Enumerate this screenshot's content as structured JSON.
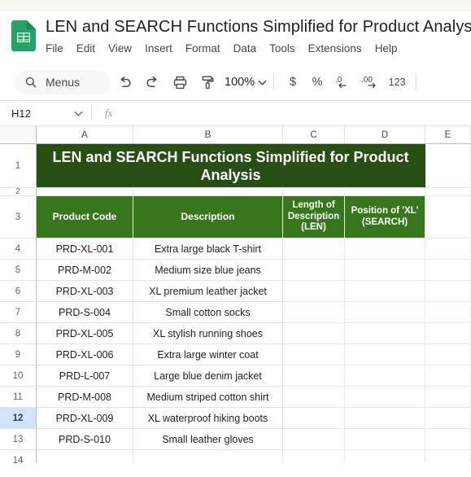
{
  "app": {
    "logo_icon": "google-sheets-icon",
    "doc_title": "LEN and SEARCH Functions Simplified for Product Analys",
    "menus": [
      "File",
      "Edit",
      "View",
      "Insert",
      "Format",
      "Data",
      "Tools",
      "Extensions",
      "Help"
    ]
  },
  "toolbar": {
    "search_icon": "search-icon",
    "search_label": "Menus",
    "undo_icon": "undo-icon",
    "redo_icon": "redo-icon",
    "print_icon": "print-icon",
    "paint_format_icon": "paint-format-icon",
    "zoom_value": "100%",
    "zoom_caret_icon": "chevron-down-icon",
    "currency_label": "$",
    "percent_label": "%",
    "decrease_decimal_label": ".0",
    "increase_decimal_label": ".00",
    "number_format_label": "123"
  },
  "formula_bar": {
    "name_box_value": "H12",
    "name_box_caret_icon": "chevron-down-icon",
    "fx_label": "fx",
    "formula_value": ""
  },
  "sheet": {
    "columns": [
      "A",
      "B",
      "C",
      "D",
      "E"
    ],
    "row_numbers": [
      "1",
      "2",
      "3",
      "4",
      "5",
      "6",
      "7",
      "8",
      "9",
      "10",
      "11",
      "12",
      "13",
      "14"
    ],
    "selected_row": "12",
    "banner_title": "LEN and SEARCH Functions Simplified for Product Analysis",
    "headers": [
      "Product Code",
      "Description",
      "Length of Description (LEN)",
      "Position of 'XL' (SEARCH)"
    ],
    "rows": [
      {
        "row": "4",
        "a": "PRD-XL-001",
        "b": "Extra large black T-shirt",
        "c": "",
        "d": ""
      },
      {
        "row": "5",
        "a": "PRD-M-002",
        "b": "Medium size blue jeans",
        "c": "",
        "d": ""
      },
      {
        "row": "6",
        "a": "PRD-XL-003",
        "b": "XL premium leather jacket",
        "c": "",
        "d": ""
      },
      {
        "row": "7",
        "a": "PRD-S-004",
        "b": "Small cotton socks",
        "c": "",
        "d": ""
      },
      {
        "row": "8",
        "a": "PRD-XL-005",
        "b": "XL stylish running shoes",
        "c": "",
        "d": ""
      },
      {
        "row": "9",
        "a": "PRD-XL-006",
        "b": "Extra large winter coat",
        "c": "",
        "d": ""
      },
      {
        "row": "10",
        "a": "PRD-L-007",
        "b": "Large blue denim jacket",
        "c": "",
        "d": ""
      },
      {
        "row": "11",
        "a": "PRD-M-008",
        "b": "Medium striped cotton shirt",
        "c": "",
        "d": ""
      },
      {
        "row": "12",
        "a": "PRD-XL-009",
        "b": "XL waterproof hiking boots",
        "c": "",
        "d": ""
      },
      {
        "row": "13",
        "a": "PRD-S-010",
        "b": "Small leather gloves",
        "c": "",
        "d": ""
      },
      {
        "row": "14",
        "a": "",
        "b": "",
        "c": "",
        "d": ""
      }
    ]
  },
  "colors": {
    "banner_green": "#274e13",
    "header_green": "#38761d",
    "selection_blue": "#d3e3fd",
    "logo_green": "#23a566"
  }
}
